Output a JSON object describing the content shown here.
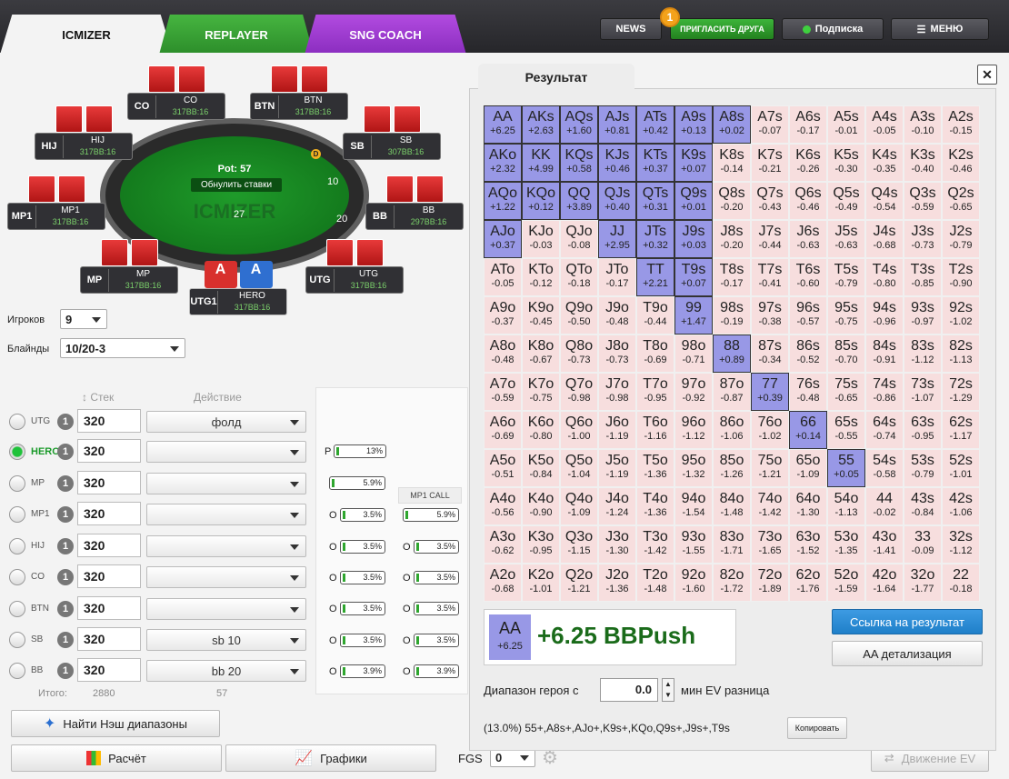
{
  "tabs": {
    "icmizer": "ICMIZER",
    "replayer": "REPLAYER",
    "sngcoach": "SNG COACH"
  },
  "topbar": {
    "news": "NEWS",
    "invite": "ПРИГЛАСИТЬ ДРУГА",
    "invite_badge": "1",
    "subscription": "Подписка",
    "menu": "МЕНЮ"
  },
  "table": {
    "pot": "Pot: 57",
    "reset": "Обнулить ставки",
    "logo": "ICMIZER",
    "sb_chips": "10",
    "bb_chips": "20",
    "center_chips": "27",
    "dealer": "D",
    "seats": {
      "co": {
        "pos": "CO",
        "name": "CO",
        "stack": "317BB:16"
      },
      "btn": {
        "pos": "BTN",
        "name": "BTN",
        "stack": "317BB:16"
      },
      "hij": {
        "pos": "HIJ",
        "name": "HIJ",
        "stack": "317BB:16"
      },
      "sb": {
        "pos": "SB",
        "name": "SB",
        "stack": "307BB:16"
      },
      "mp1": {
        "pos": "MP1",
        "name": "MP1",
        "stack": "317BB:16"
      },
      "bb": {
        "pos": "BB",
        "name": "BB",
        "stack": "297BB:16"
      },
      "mp": {
        "pos": "MP",
        "name": "MP",
        "stack": "317BB:16"
      },
      "utg": {
        "pos": "UTG",
        "name": "UTG",
        "stack": "317BB:16"
      },
      "hero": {
        "pos": "UTG1",
        "name": "HERO",
        "stack": "317BB:16",
        "card1": "A",
        "card2": "A"
      }
    }
  },
  "settings": {
    "players_label": "Игроков",
    "players_value": "9",
    "blinds_label": "Блайнды",
    "blinds_value": "10/20-3"
  },
  "players_table": {
    "stack_header": "Стек",
    "action_header": "Действие",
    "total_label": "Итого:",
    "total_stack": "2880",
    "total_action": "57",
    "rows": [
      {
        "pos": "UTG",
        "num": "1",
        "stack": "320",
        "action": "фолд"
      },
      {
        "pos": "HERO",
        "num": "1",
        "stack": "320",
        "action": ""
      },
      {
        "pos": "MP",
        "num": "1",
        "stack": "320",
        "action": ""
      },
      {
        "pos": "MP1",
        "num": "1",
        "stack": "320",
        "action": ""
      },
      {
        "pos": "HIJ",
        "num": "1",
        "stack": "320",
        "action": ""
      },
      {
        "pos": "CO",
        "num": "1",
        "stack": "320",
        "action": ""
      },
      {
        "pos": "BTN",
        "num": "1",
        "stack": "320",
        "action": ""
      },
      {
        "pos": "SB",
        "num": "1",
        "stack": "320",
        "action": "sb 10"
      },
      {
        "pos": "BB",
        "num": "1",
        "stack": "320",
        "action": "bb 20"
      }
    ]
  },
  "ranges": {
    "p_label": "P",
    "p_value": "13%",
    "col2_header": "MP1 CALL",
    "col1": [
      "5.9%",
      "3.5%",
      "3.5%",
      "3.5%",
      "3.5%",
      "3.5%",
      "3.9%"
    ],
    "col1_prefix": "O",
    "col2": [
      "5.9%",
      "3.5%",
      "3.5%",
      "3.5%",
      "3.5%",
      "3.9%"
    ]
  },
  "buttons": {
    "nash": "Найти Нэш диапазоны",
    "calc": "Расчёт",
    "graphs": "Графики",
    "fgs_label": "FGS",
    "fgs_value": "0",
    "ev_move": "Движение EV"
  },
  "result": {
    "tab": "Результат",
    "close": "✕",
    "link": "Ссылка на результат",
    "detail": "AA детализация",
    "hero_range_label": "Диапазон героя с",
    "min_ev": "0.0",
    "min_ev_suffix": "мин EV разница",
    "range_text": "(13.0%) 55+,A8s+,AJo+,K9s+,KQo,Q9s+,J9s+,T9s",
    "copy": "Копировать",
    "sum_hand": "AA",
    "sum_ev": "+6.25",
    "sum_big": "+6.25 BBPush"
  },
  "matrix": [
    [
      [
        "AA",
        "+6.25"
      ],
      [
        "AKs",
        "+2.63"
      ],
      [
        "AQs",
        "+1.60"
      ],
      [
        "AJs",
        "+0.81"
      ],
      [
        "ATs",
        "+0.42"
      ],
      [
        "A9s",
        "+0.13"
      ],
      [
        "A8s",
        "+0.02"
      ],
      [
        "A7s",
        "-0.07"
      ],
      [
        "A6s",
        "-0.17"
      ],
      [
        "A5s",
        "-0.01"
      ],
      [
        "A4s",
        "-0.05"
      ],
      [
        "A3s",
        "-0.10"
      ],
      [
        "A2s",
        "-0.15"
      ]
    ],
    [
      [
        "AKo",
        "+2.32"
      ],
      [
        "KK",
        "+4.99"
      ],
      [
        "KQs",
        "+0.58"
      ],
      [
        "KJs",
        "+0.46"
      ],
      [
        "KTs",
        "+0.37"
      ],
      [
        "K9s",
        "+0.07"
      ],
      [
        "K8s",
        "-0.14"
      ],
      [
        "K7s",
        "-0.21"
      ],
      [
        "K6s",
        "-0.26"
      ],
      [
        "K5s",
        "-0.30"
      ],
      [
        "K4s",
        "-0.35"
      ],
      [
        "K3s",
        "-0.40"
      ],
      [
        "K2s",
        "-0.46"
      ]
    ],
    [
      [
        "AQo",
        "+1.22"
      ],
      [
        "KQo",
        "+0.12"
      ],
      [
        "QQ",
        "+3.89"
      ],
      [
        "QJs",
        "+0.40"
      ],
      [
        "QTs",
        "+0.31"
      ],
      [
        "Q9s",
        "+0.01"
      ],
      [
        "Q8s",
        "-0.20"
      ],
      [
        "Q7s",
        "-0.43"
      ],
      [
        "Q6s",
        "-0.46"
      ],
      [
        "Q5s",
        "-0.49"
      ],
      [
        "Q4s",
        "-0.54"
      ],
      [
        "Q3s",
        "-0.59"
      ],
      [
        "Q2s",
        "-0.65"
      ]
    ],
    [
      [
        "AJo",
        "+0.37"
      ],
      [
        "KJo",
        "-0.03"
      ],
      [
        "QJo",
        "-0.08"
      ],
      [
        "JJ",
        "+2.95"
      ],
      [
        "JTs",
        "+0.32"
      ],
      [
        "J9s",
        "+0.03"
      ],
      [
        "J8s",
        "-0.20"
      ],
      [
        "J7s",
        "-0.44"
      ],
      [
        "J6s",
        "-0.63"
      ],
      [
        "J5s",
        "-0.63"
      ],
      [
        "J4s",
        "-0.68"
      ],
      [
        "J3s",
        "-0.73"
      ],
      [
        "J2s",
        "-0.79"
      ]
    ],
    [
      [
        "ATo",
        "-0.05"
      ],
      [
        "KTo",
        "-0.12"
      ],
      [
        "QTo",
        "-0.18"
      ],
      [
        "JTo",
        "-0.17"
      ],
      [
        "TT",
        "+2.21"
      ],
      [
        "T9s",
        "+0.07"
      ],
      [
        "T8s",
        "-0.17"
      ],
      [
        "T7s",
        "-0.41"
      ],
      [
        "T6s",
        "-0.60"
      ],
      [
        "T5s",
        "-0.79"
      ],
      [
        "T4s",
        "-0.80"
      ],
      [
        "T3s",
        "-0.85"
      ],
      [
        "T2s",
        "-0.90"
      ]
    ],
    [
      [
        "A9o",
        "-0.37"
      ],
      [
        "K9o",
        "-0.45"
      ],
      [
        "Q9o",
        "-0.50"
      ],
      [
        "J9o",
        "-0.48"
      ],
      [
        "T9o",
        "-0.44"
      ],
      [
        "99",
        "+1.47"
      ],
      [
        "98s",
        "-0.19"
      ],
      [
        "97s",
        "-0.38"
      ],
      [
        "96s",
        "-0.57"
      ],
      [
        "95s",
        "-0.75"
      ],
      [
        "94s",
        "-0.96"
      ],
      [
        "93s",
        "-0.97"
      ],
      [
        "92s",
        "-1.02"
      ]
    ],
    [
      [
        "A8o",
        "-0.48"
      ],
      [
        "K8o",
        "-0.67"
      ],
      [
        "Q8o",
        "-0.73"
      ],
      [
        "J8o",
        "-0.73"
      ],
      [
        "T8o",
        "-0.69"
      ],
      [
        "98o",
        "-0.71"
      ],
      [
        "88",
        "+0.89"
      ],
      [
        "87s",
        "-0.34"
      ],
      [
        "86s",
        "-0.52"
      ],
      [
        "85s",
        "-0.70"
      ],
      [
        "84s",
        "-0.91"
      ],
      [
        "83s",
        "-1.12"
      ],
      [
        "82s",
        "-1.13"
      ]
    ],
    [
      [
        "A7o",
        "-0.59"
      ],
      [
        "K7o",
        "-0.75"
      ],
      [
        "Q7o",
        "-0.98"
      ],
      [
        "J7o",
        "-0.98"
      ],
      [
        "T7o",
        "-0.95"
      ],
      [
        "97o",
        "-0.92"
      ],
      [
        "87o",
        "-0.87"
      ],
      [
        "77",
        "+0.39"
      ],
      [
        "76s",
        "-0.48"
      ],
      [
        "75s",
        "-0.65"
      ],
      [
        "74s",
        "-0.86"
      ],
      [
        "73s",
        "-1.07"
      ],
      [
        "72s",
        "-1.29"
      ]
    ],
    [
      [
        "A6o",
        "-0.69"
      ],
      [
        "K6o",
        "-0.80"
      ],
      [
        "Q6o",
        "-1.00"
      ],
      [
        "J6o",
        "-1.19"
      ],
      [
        "T6o",
        "-1.16"
      ],
      [
        "96o",
        "-1.12"
      ],
      [
        "86o",
        "-1.06"
      ],
      [
        "76o",
        "-1.02"
      ],
      [
        "66",
        "+0.14"
      ],
      [
        "65s",
        "-0.55"
      ],
      [
        "64s",
        "-0.74"
      ],
      [
        "63s",
        "-0.95"
      ],
      [
        "62s",
        "-1.17"
      ]
    ],
    [
      [
        "A5o",
        "-0.51"
      ],
      [
        "K5o",
        "-0.84"
      ],
      [
        "Q5o",
        "-1.04"
      ],
      [
        "J5o",
        "-1.19"
      ],
      [
        "T5o",
        "-1.36"
      ],
      [
        "95o",
        "-1.32"
      ],
      [
        "85o",
        "-1.26"
      ],
      [
        "75o",
        "-1.21"
      ],
      [
        "65o",
        "-1.09"
      ],
      [
        "55",
        "+0.05"
      ],
      [
        "54s",
        "-0.58"
      ],
      [
        "53s",
        "-0.79"
      ],
      [
        "52s",
        "-1.01"
      ]
    ],
    [
      [
        "A4o",
        "-0.56"
      ],
      [
        "K4o",
        "-0.90"
      ],
      [
        "Q4o",
        "-1.09"
      ],
      [
        "J4o",
        "-1.24"
      ],
      [
        "T4o",
        "-1.36"
      ],
      [
        "94o",
        "-1.54"
      ],
      [
        "84o",
        "-1.48"
      ],
      [
        "74o",
        "-1.42"
      ],
      [
        "64o",
        "-1.30"
      ],
      [
        "54o",
        "-1.13"
      ],
      [
        "44",
        "-0.02"
      ],
      [
        "43s",
        "-0.84"
      ],
      [
        "42s",
        "-1.06"
      ]
    ],
    [
      [
        "A3o",
        "-0.62"
      ],
      [
        "K3o",
        "-0.95"
      ],
      [
        "Q3o",
        "-1.15"
      ],
      [
        "J3o",
        "-1.30"
      ],
      [
        "T3o",
        "-1.42"
      ],
      [
        "93o",
        "-1.55"
      ],
      [
        "83o",
        "-1.71"
      ],
      [
        "73o",
        "-1.65"
      ],
      [
        "63o",
        "-1.52"
      ],
      [
        "53o",
        "-1.35"
      ],
      [
        "43o",
        "-1.41"
      ],
      [
        "33",
        "-0.09"
      ],
      [
        "32s",
        "-1.12"
      ]
    ],
    [
      [
        "A2o",
        "-0.68"
      ],
      [
        "K2o",
        "-1.01"
      ],
      [
        "Q2o",
        "-1.21"
      ],
      [
        "J2o",
        "-1.36"
      ],
      [
        "T2o",
        "-1.48"
      ],
      [
        "92o",
        "-1.60"
      ],
      [
        "82o",
        "-1.72"
      ],
      [
        "72o",
        "-1.89"
      ],
      [
        "62o",
        "-1.76"
      ],
      [
        "52o",
        "-1.59"
      ],
      [
        "42o",
        "-1.64"
      ],
      [
        "32o",
        "-1.77"
      ],
      [
        "22",
        "-0.18"
      ]
    ]
  ]
}
